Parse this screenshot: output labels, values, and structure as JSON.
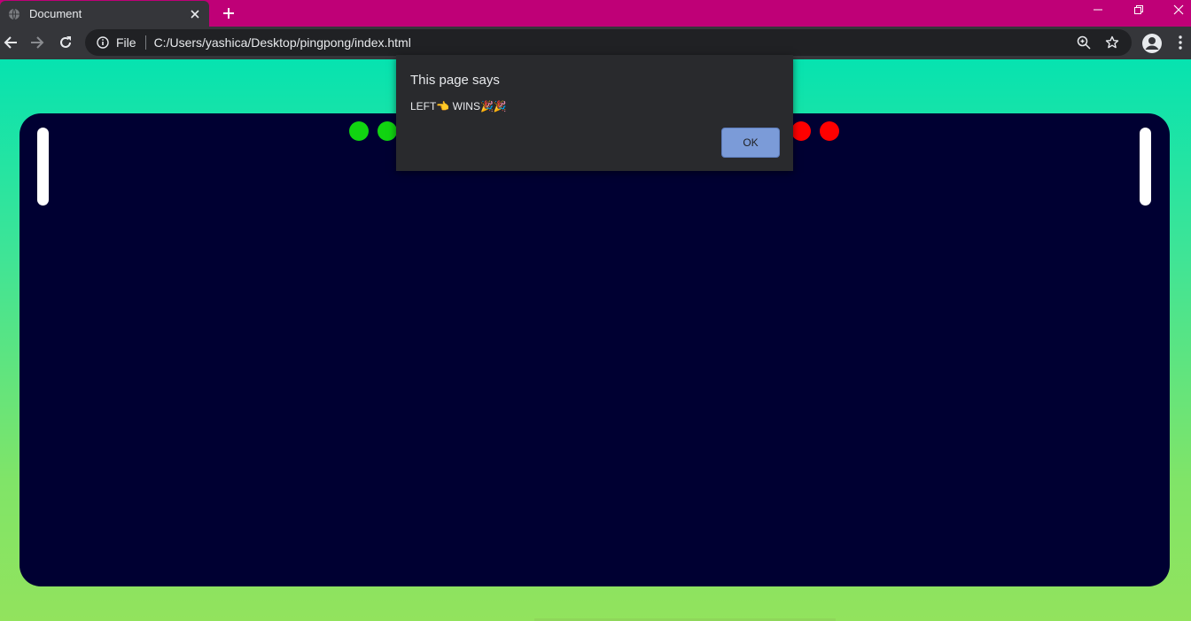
{
  "browser": {
    "tab": {
      "title": "Document",
      "close_icon": "close-icon",
      "favicon": "globe-icon"
    },
    "new_tab_icon": "plus-icon",
    "window_controls": [
      "minimize-icon",
      "restore-icon",
      "close-icon"
    ],
    "toolbar": {
      "back_icon": "back-arrow-icon",
      "forward_icon": "forward-arrow-icon",
      "reload_icon": "reload-icon",
      "scheme_label": "File",
      "url": "C:/Users/yashica/Desktop/pingpong/index.html",
      "zoom_icon": "zoom-icon",
      "bookmark_icon": "star-icon",
      "profile_icon": "account-icon",
      "menu_icon": "more-vert-icon"
    },
    "colors": {
      "tabstrip": "#bf0077",
      "toolbar": "#35363a",
      "omnibox": "#202124"
    }
  },
  "page": {
    "background_gradient": [
      "#06e3b0",
      "#92e35d"
    ],
    "board": {
      "color": "#000032",
      "left_paddle_color": "#ffffff",
      "right_paddle_color": "#ffffff",
      "left_score_dots": {
        "count_visible": 2,
        "color": "#11d411"
      },
      "right_score_dots": {
        "count_visible": 2,
        "color": "#ff0000"
      }
    }
  },
  "dialog": {
    "title": "This page says",
    "message": "LEFT👈 WINS🎉🎉",
    "ok_label": "OK"
  }
}
